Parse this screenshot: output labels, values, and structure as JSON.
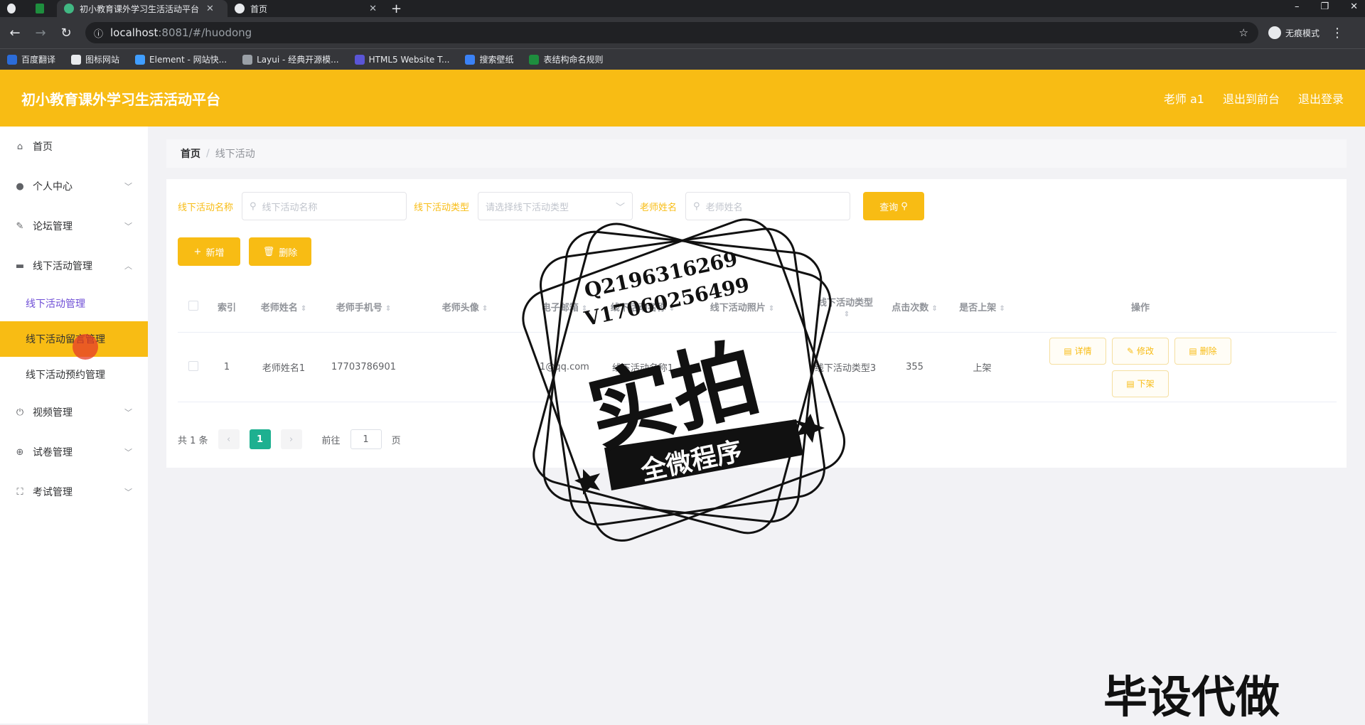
{
  "browser": {
    "tabs": [
      {
        "label": "初小教育课外学习生活活动平台",
        "active": true
      },
      {
        "label": "首页",
        "active": false
      }
    ],
    "url_host": "localhost",
    "url_path": ":8081/#/huodong",
    "profile_label": "无痕模式",
    "bookmarks": [
      "百度翻译",
      "图标网站",
      "Element - 网站快...",
      "Layui - 经典开源模...",
      "HTML5 Website T...",
      "搜索壁纸",
      "表结构命名规则"
    ]
  },
  "header": {
    "title": "初小教育课外学习生活活动平台",
    "user": "老师 a1",
    "back_front": "退出到前台",
    "logout": "退出登录"
  },
  "sidebar": {
    "items": [
      {
        "label": "首页",
        "icon": "home-icon",
        "expandable": false
      },
      {
        "label": "个人中心",
        "icon": "user-icon",
        "expandable": true
      },
      {
        "label": "论坛管理",
        "icon": "forum-icon",
        "expandable": true
      },
      {
        "label": "线下活动管理",
        "icon": "monitor-icon",
        "expandable": true,
        "expanded": true
      },
      {
        "label": "视频管理",
        "icon": "power-icon",
        "expandable": true
      },
      {
        "label": "试卷管理",
        "icon": "target-icon",
        "expandable": true
      },
      {
        "label": "考试管理",
        "icon": "frame-icon",
        "expandable": true
      }
    ],
    "subitems": [
      "线下活动管理",
      "线下活动留言管理",
      "线下活动预约管理"
    ]
  },
  "breadcrumb": {
    "home": "首页",
    "current": "线下活动"
  },
  "search": {
    "name_label": "线下活动名称",
    "name_placeholder": "线下活动名称",
    "type_label": "线下活动类型",
    "type_placeholder": "请选择线下活动类型",
    "teacher_label": "老师姓名",
    "teacher_placeholder": "老师姓名",
    "query_button": "查询"
  },
  "actions": {
    "add": "新增",
    "delete": "删除"
  },
  "table": {
    "columns": [
      "索引",
      "老师姓名",
      "老师手机号",
      "老师头像",
      "电子邮箱",
      "线下活动名称",
      "线下活动照片",
      "线下活动类型",
      "点击次数",
      "是否上架",
      "操作"
    ],
    "rows": [
      {
        "index": "1",
        "teacher_name": "老师姓名1",
        "phone": "17703786901",
        "avatar": "",
        "email": "1@qq.com",
        "activity_name": "线下活动名称1",
        "photo": "",
        "activity_type": "线下活动类型3",
        "clicks": "355",
        "on_sale": "上架",
        "ops": [
          "详情",
          "修改",
          "删除",
          "下架"
        ]
      }
    ]
  },
  "pager": {
    "total": "共 1 条",
    "current_page": "1",
    "goto_label": "前往",
    "goto_value": "1",
    "page_unit": "页"
  },
  "watermark": {
    "contact_q": "Q2196316269",
    "contact_v": "V17060256499",
    "big": "实拍",
    "ribbon": "全微程序",
    "corner": "毕设代做"
  },
  "colors": {
    "accent": "#f8bc14",
    "page_active": "#1eb090",
    "submenu_current": "#6f4ed6"
  }
}
